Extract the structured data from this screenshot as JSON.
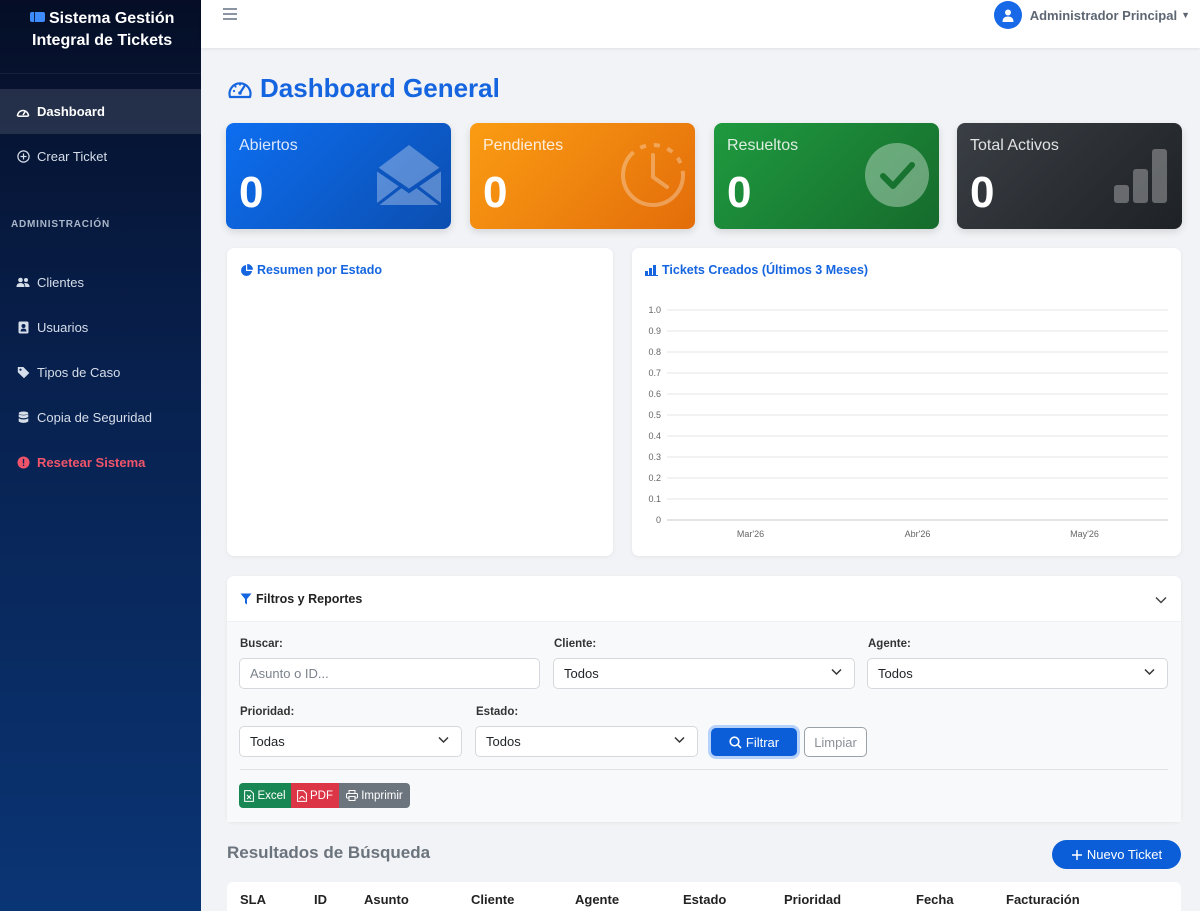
{
  "sidebar": {
    "brand_line1": "Sistema Gestión",
    "brand_line2": "Integral de Tickets",
    "items": [
      {
        "label": "Dashboard",
        "icon": "gauge-icon"
      },
      {
        "label": "Crear Ticket",
        "icon": "plus-circle-icon"
      }
    ],
    "section_label": "ADMINISTRACIÓN",
    "admin_items": [
      {
        "label": "Clientes",
        "icon": "users-icon"
      },
      {
        "label": "Usuarios",
        "icon": "user-card-icon"
      },
      {
        "label": "Tipos de Caso",
        "icon": "tag-icon"
      },
      {
        "label": "Copia de Seguridad",
        "icon": "database-icon"
      },
      {
        "label": "Resetear Sistema",
        "icon": "alert-circle-icon"
      }
    ]
  },
  "topbar": {
    "user_name": "Administrador Principal"
  },
  "page_title": "Dashboard General",
  "stats": [
    {
      "label": "Abiertos",
      "value": "0",
      "color": "#0d6ef0"
    },
    {
      "label": "Pendientes",
      "value": "0",
      "color": "#fb9c13"
    },
    {
      "label": "Resueltos",
      "value": "0",
      "color": "#1f9a3f"
    },
    {
      "label": "Total Activos",
      "value": "0",
      "color": "#2c3035"
    }
  ],
  "status_panel": {
    "title": "Resumen por Estado"
  },
  "tickets_panel": {
    "title": "Tickets Creados (Últimos 3 Meses)"
  },
  "chart_data": {
    "type": "line",
    "title": "Tickets Creados (Últimos 3 Meses)",
    "categories": [
      "Mar'26",
      "Abr'26",
      "May'26"
    ],
    "series": [],
    "yticks": [
      "0",
      "0.1",
      "0.2",
      "0.3",
      "0.4",
      "0.5",
      "0.6",
      "0.7",
      "0.8",
      "0.9",
      "1.0"
    ],
    "ylim": [
      0,
      1
    ],
    "grid": true
  },
  "filters": {
    "title": "Filtros y Reportes",
    "search_label": "Buscar:",
    "search_placeholder": "Asunto o ID...",
    "client_label": "Cliente:",
    "client_value": "Todos",
    "agent_label": "Agente:",
    "agent_value": "Todos",
    "priority_label": "Prioridad:",
    "priority_value": "Todas",
    "status_label": "Estado:",
    "status_value": "Todos",
    "filter_button": "Filtrar",
    "clear_button": "Limpiar",
    "export_excel": "Excel",
    "export_pdf": "PDF",
    "print": "Imprimir",
    "colors": {
      "excel": "#198754",
      "pdf": "#dc3545",
      "print": "#6c757d"
    }
  },
  "results": {
    "title": "Resultados de Búsqueda",
    "new_ticket": "Nuevo Ticket",
    "columns": [
      "SLA",
      "ID",
      "Asunto",
      "Cliente",
      "Agente",
      "Estado",
      "Prioridad",
      "Fecha",
      "Facturación"
    ]
  }
}
